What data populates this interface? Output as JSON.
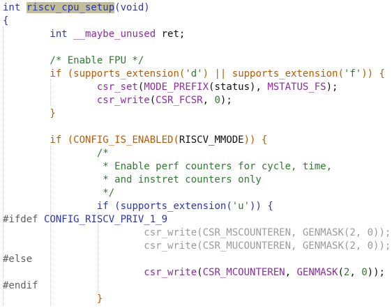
{
  "editor": {
    "lines": [
      {
        "id": "l1",
        "segments": [
          {
            "text": "int ",
            "cls": "kw"
          },
          {
            "text": "riscv_cpu_setup",
            "cls": "highlight"
          },
          {
            "text": "(void)",
            "cls": "kw"
          }
        ]
      },
      {
        "id": "l2",
        "segments": [
          {
            "text": "{",
            "cls": "kw"
          }
        ]
      },
      {
        "id": "l3",
        "segments": [
          {
            "text": "        int ",
            "cls": "kw"
          },
          {
            "text": "__maybe_unused",
            "cls": "mac"
          },
          {
            "text": " ret;",
            "cls": "punc"
          }
        ]
      },
      {
        "id": "l4",
        "segments": [
          {
            "text": "",
            "cls": "punc"
          }
        ]
      },
      {
        "id": "l5",
        "segments": [
          {
            "text": "        /* Enable FPU */",
            "cls": "cmt"
          }
        ]
      },
      {
        "id": "l6",
        "segments": [
          {
            "text": "        if ",
            "cls": "orange"
          },
          {
            "text": "(",
            "cls": "orange"
          },
          {
            "text": "supports_extension",
            "cls": "orange"
          },
          {
            "text": "(",
            "cls": "orange"
          },
          {
            "text": "'d'",
            "cls": "str"
          },
          {
            "text": ") || ",
            "cls": "orange"
          },
          {
            "text": "supports_extension",
            "cls": "orange"
          },
          {
            "text": "(",
            "cls": "orange"
          },
          {
            "text": "'f'",
            "cls": "str"
          },
          {
            "text": ")) {",
            "cls": "orange"
          }
        ]
      },
      {
        "id": "l7",
        "segments": [
          {
            "text": "                ",
            "cls": "punc"
          },
          {
            "text": "csr_set",
            "cls": "fn"
          },
          {
            "text": "(",
            "cls": "punc"
          },
          {
            "text": "MODE_PREFIX",
            "cls": "mac"
          },
          {
            "text": "(status), ",
            "cls": "punc"
          },
          {
            "text": "MSTATUS_FS",
            "cls": "mac"
          },
          {
            "text": ");",
            "cls": "punc"
          }
        ]
      },
      {
        "id": "l8",
        "segments": [
          {
            "text": "                ",
            "cls": "punc"
          },
          {
            "text": "csr_write",
            "cls": "fn"
          },
          {
            "text": "(",
            "cls": "punc"
          },
          {
            "text": "CSR_FCSR",
            "cls": "mac"
          },
          {
            "text": ", ",
            "cls": "punc"
          },
          {
            "text": "0",
            "cls": "num"
          },
          {
            "text": ");",
            "cls": "punc"
          }
        ]
      },
      {
        "id": "l9",
        "segments": [
          {
            "text": "        }",
            "cls": "orange"
          }
        ]
      },
      {
        "id": "l10",
        "segments": [
          {
            "text": "",
            "cls": "punc"
          }
        ]
      },
      {
        "id": "l11",
        "segments": [
          {
            "text": "        if ",
            "cls": "orange"
          },
          {
            "text": "(",
            "cls": "orange"
          },
          {
            "text": "CONFIG_IS_ENABLED",
            "cls": "orange"
          },
          {
            "text": "(",
            "cls": "orange"
          },
          {
            "text": "RISCV_MMODE",
            "cls": "punc"
          },
          {
            "text": ")) {",
            "cls": "orange"
          }
        ]
      },
      {
        "id": "l12",
        "segments": [
          {
            "text": "                /*",
            "cls": "cmt"
          }
        ]
      },
      {
        "id": "l13",
        "segments": [
          {
            "text": "                 * Enable perf counters for cycle, time,",
            "cls": "cmt"
          }
        ]
      },
      {
        "id": "l14",
        "segments": [
          {
            "text": "                 * and instret counters only",
            "cls": "cmt"
          }
        ]
      },
      {
        "id": "l15",
        "segments": [
          {
            "text": "                 */",
            "cls": "cmt"
          }
        ]
      },
      {
        "id": "l16",
        "segments": [
          {
            "text": "                if ",
            "cls": "kw"
          },
          {
            "text": "(",
            "cls": "kw"
          },
          {
            "text": "supports_extension",
            "cls": "kw"
          },
          {
            "text": "(",
            "cls": "kw"
          },
          {
            "text": "'u'",
            "cls": "str"
          },
          {
            "text": ")) {",
            "cls": "kw"
          }
        ]
      },
      {
        "id": "l17",
        "segments": [
          {
            "text": "#ifdef ",
            "cls": "pp"
          },
          {
            "text": "CONFIG_RISCV_PRIV_1_9",
            "cls": "ppname"
          }
        ]
      },
      {
        "id": "l18",
        "segments": [
          {
            "text": "                        ",
            "cls": "punc"
          },
          {
            "text": "csr_write",
            "cls": "inactive"
          },
          {
            "text": "(CSR_MSCOUNTEREN, ",
            "cls": "inactive"
          },
          {
            "text": "GENMASK",
            "cls": "inactive"
          },
          {
            "text": "(2, 0));",
            "cls": "inactive"
          }
        ]
      },
      {
        "id": "l19",
        "segments": [
          {
            "text": "                        ",
            "cls": "punc"
          },
          {
            "text": "csr_write",
            "cls": "inactive"
          },
          {
            "text": "(CSR_MUCOUNTEREN, ",
            "cls": "inactive"
          },
          {
            "text": "GENMASK",
            "cls": "inactive"
          },
          {
            "text": "(2, 0));",
            "cls": "inactive"
          }
        ]
      },
      {
        "id": "l20",
        "segments": [
          {
            "text": "#else",
            "cls": "pp"
          }
        ]
      },
      {
        "id": "l21",
        "segments": [
          {
            "text": "                        ",
            "cls": "punc"
          },
          {
            "text": "csr_write",
            "cls": "fn"
          },
          {
            "text": "(",
            "cls": "punc"
          },
          {
            "text": "CSR_MCOUNTEREN",
            "cls": "mac"
          },
          {
            "text": ", ",
            "cls": "punc"
          },
          {
            "text": "GENMASK",
            "cls": "mac"
          },
          {
            "text": "(",
            "cls": "punc"
          },
          {
            "text": "2",
            "cls": "num"
          },
          {
            "text": ", ",
            "cls": "punc"
          },
          {
            "text": "0",
            "cls": "num"
          },
          {
            "text": "));",
            "cls": "punc"
          }
        ]
      },
      {
        "id": "l22",
        "segments": [
          {
            "text": "#endif",
            "cls": "pp"
          }
        ]
      },
      {
        "id": "l23",
        "segments": [
          {
            "text": "                }",
            "cls": "orange"
          }
        ]
      }
    ]
  }
}
